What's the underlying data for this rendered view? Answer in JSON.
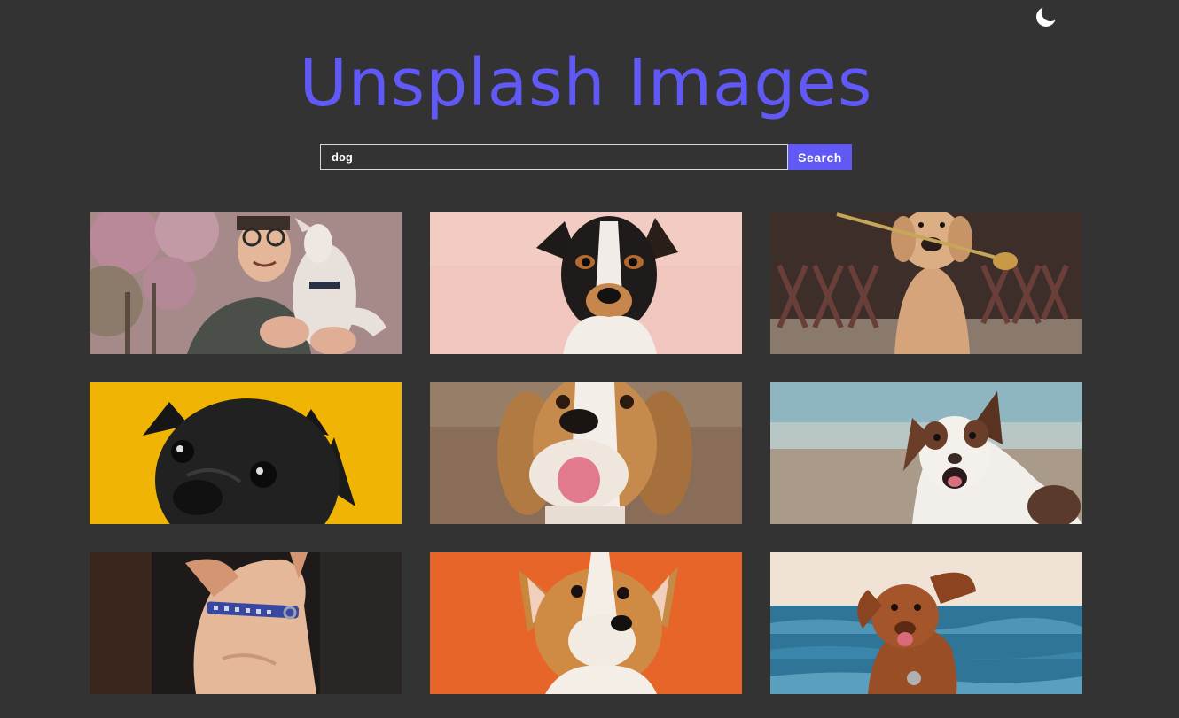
{
  "header": {
    "title": "Unsplash Images",
    "theme_toggle_icon": "moon-icon"
  },
  "search": {
    "value": "dog",
    "button_label": "Search"
  },
  "colors": {
    "accent": "#6059f5",
    "background": "#333333"
  },
  "images": [
    {
      "subject": "man with white dog by blossom tree"
    },
    {
      "subject": "black tan and white terrier on pink"
    },
    {
      "subject": "golden retriever with rose in mouth"
    },
    {
      "subject": "black pug on yellow"
    },
    {
      "subject": "smiling beagle"
    },
    {
      "subject": "australian shepherd on beach"
    },
    {
      "subject": "tan dog with blue collar"
    },
    {
      "subject": "corgi puppy on orange"
    },
    {
      "subject": "brown dog by the sea"
    }
  ]
}
